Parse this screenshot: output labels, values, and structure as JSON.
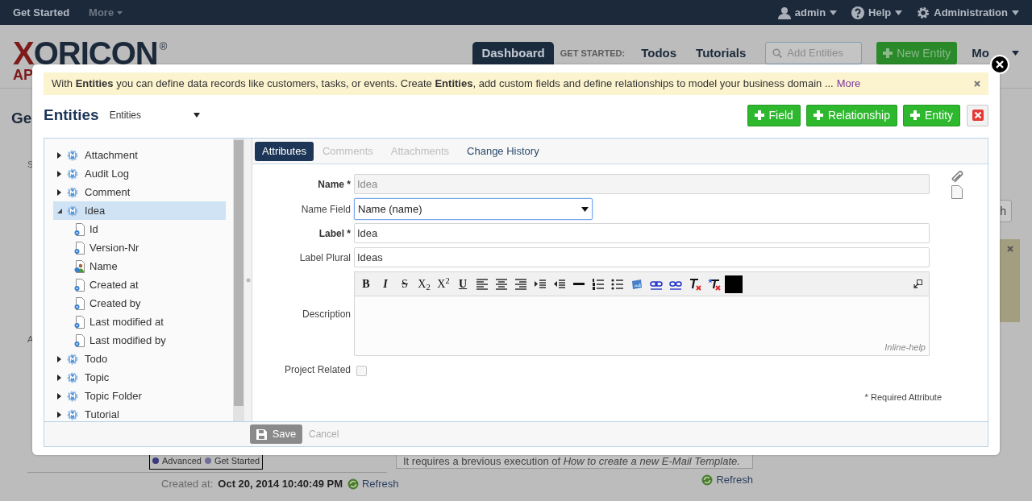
{
  "top_nav": {
    "left": [
      {
        "label": "Get Started",
        "dropdown": false
      },
      {
        "label": "More",
        "dropdown": true
      }
    ],
    "right": [
      {
        "kind": "user",
        "label": "admin"
      },
      {
        "kind": "help",
        "label": "Help"
      },
      {
        "kind": "gear",
        "label": "Administration"
      }
    ]
  },
  "header": {
    "logo": "XORICON",
    "logo_mark": "®",
    "logo_sub": "AP",
    "nav": [
      {
        "kind": "tab",
        "label": "Dashboard",
        "selected": true
      },
      {
        "kind": "label",
        "label": "GET STARTED:"
      },
      {
        "kind": "tab",
        "label": "Todos",
        "selected": false
      },
      {
        "kind": "tab",
        "label": "Tutorials",
        "selected": false
      }
    ],
    "search_placeholder": "Add Entities",
    "new_button": "New Entity",
    "more_menu": "Mo"
  },
  "page": {
    "heading": "Ge",
    "left_letters": [
      "S",
      "A"
    ],
    "right_button": "h"
  },
  "page_footer": {
    "legend": [
      {
        "label": "Advanced",
        "color": "#3a3a7c"
      },
      {
        "label": "Get Started",
        "color": "#6e6e98"
      }
    ],
    "created_label": "Created at:",
    "created_value": "Oct 20, 2014 10:40:49 PM",
    "refresh": "Refresh",
    "note": "It requires a brevious execution of *How to create a new E-Mail Template.*",
    "note_refresh": "Refresh"
  },
  "modal": {
    "alert": {
      "text": "With **Entities** you can define data records like customers, tasks, or events. Create **Entities**, add custom fields and define relationships to model your business domain ...",
      "link": "More"
    },
    "title": "Entities",
    "selector": "Entities",
    "buttons": [
      {
        "label": "Field"
      },
      {
        "label": "Relationship"
      },
      {
        "label": "Entity"
      }
    ],
    "tree": [
      {
        "label": "Attachment",
        "kind": "entity",
        "expanded": false,
        "selected": false
      },
      {
        "label": "Audit Log",
        "kind": "entity",
        "expanded": false,
        "selected": false
      },
      {
        "label": "Comment",
        "kind": "entity",
        "expanded": false,
        "selected": false
      },
      {
        "label": "Idea",
        "kind": "entity",
        "expanded": true,
        "selected": true,
        "children": [
          {
            "label": "Id",
            "kind": "attribute"
          },
          {
            "label": "Version-Nr",
            "kind": "attribute"
          },
          {
            "label": "Name",
            "kind": "person_attribute"
          },
          {
            "label": "Created at",
            "kind": "attribute"
          },
          {
            "label": "Created by",
            "kind": "attribute"
          },
          {
            "label": "Last modified at",
            "kind": "attribute"
          },
          {
            "label": "Last modified by",
            "kind": "attribute"
          }
        ]
      },
      {
        "label": "Todo",
        "kind": "entity",
        "expanded": false,
        "selected": false
      },
      {
        "label": "Topic",
        "kind": "entity",
        "expanded": false,
        "selected": false
      },
      {
        "label": "Topic Folder",
        "kind": "entity",
        "expanded": false,
        "selected": false
      },
      {
        "label": "Tutorial",
        "kind": "entity",
        "expanded": false,
        "selected": false
      }
    ],
    "tabs": [
      {
        "label": "Attributes",
        "selected": true,
        "disabled": false
      },
      {
        "label": "Comments",
        "selected": false,
        "disabled": true
      },
      {
        "label": "Attachments",
        "selected": false,
        "disabled": true
      },
      {
        "label": "Change History",
        "selected": false,
        "disabled": false
      }
    ],
    "fields": [
      {
        "kind": "text",
        "label": "Name *",
        "required": true,
        "value": "Idea",
        "readonly": true
      },
      {
        "kind": "select",
        "label": "Name Field",
        "required": false,
        "value": "Name (name)",
        "focused": true
      },
      {
        "kind": "text",
        "label": "Label *",
        "required": true,
        "value": "Idea",
        "readonly": false
      },
      {
        "kind": "text",
        "label": "Label Plural",
        "required": false,
        "value": "Ideas",
        "readonly": false
      },
      {
        "kind": "rich",
        "label": "Description",
        "required": false,
        "hint": "Inline-help"
      },
      {
        "kind": "checkbox",
        "label": "Project Related",
        "required": false,
        "checked": false
      }
    ],
    "toolbar": [
      {
        "kind": "bold",
        "text": "B"
      },
      {
        "kind": "italic",
        "text": "I"
      },
      {
        "kind": "strike",
        "text": "S"
      },
      {
        "kind": "subscript",
        "text": "X$_{2}$"
      },
      {
        "kind": "superscript",
        "text": "X$^{2}$"
      },
      {
        "kind": "underline",
        "text": "U"
      },
      {
        "kind": "align-left"
      },
      {
        "kind": "align-center"
      },
      {
        "kind": "align-right"
      },
      {
        "kind": "indent"
      },
      {
        "kind": "outdent"
      },
      {
        "kind": "rule"
      },
      {
        "kind": "numbered-list"
      },
      {
        "kind": "bullet-list"
      },
      {
        "kind": "image"
      },
      {
        "kind": "link"
      },
      {
        "kind": "unlink"
      },
      {
        "kind": "clear-format"
      },
      {
        "kind": "clear-all"
      },
      {
        "kind": "color"
      }
    ],
    "required_note": "* Required Attribute",
    "save": "Save",
    "cancel": "Cancel"
  }
}
